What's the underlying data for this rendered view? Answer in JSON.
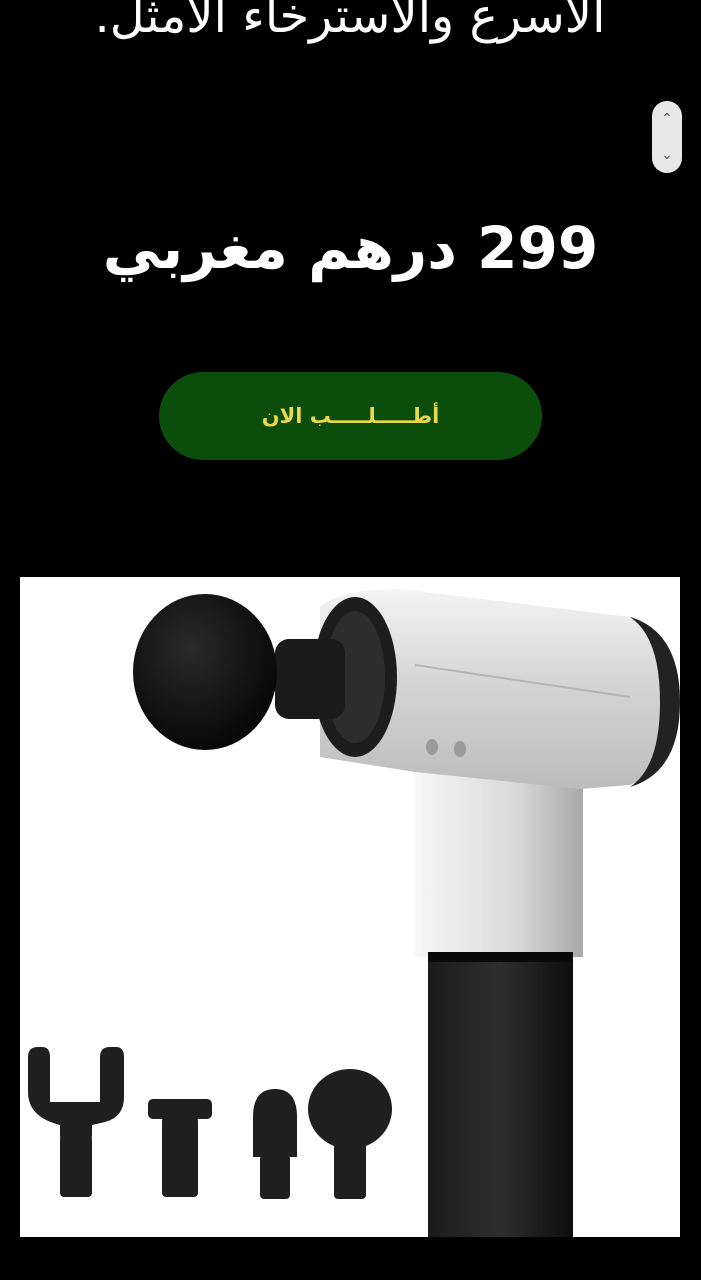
{
  "hero": {
    "headline": "الأسرع والاسترخاء الأمثل.",
    "price": "299 درهم مغربي"
  },
  "cta": {
    "label": "أطـــــلـــــب الان",
    "background_color": "#0b4d0b",
    "text_color": "#e9d94a"
  },
  "scroll_control": {
    "up_icon": "chevron-up-icon",
    "down_icon": "chevron-down-icon"
  },
  "product": {
    "image": "massage-gun-with-attachments"
  }
}
